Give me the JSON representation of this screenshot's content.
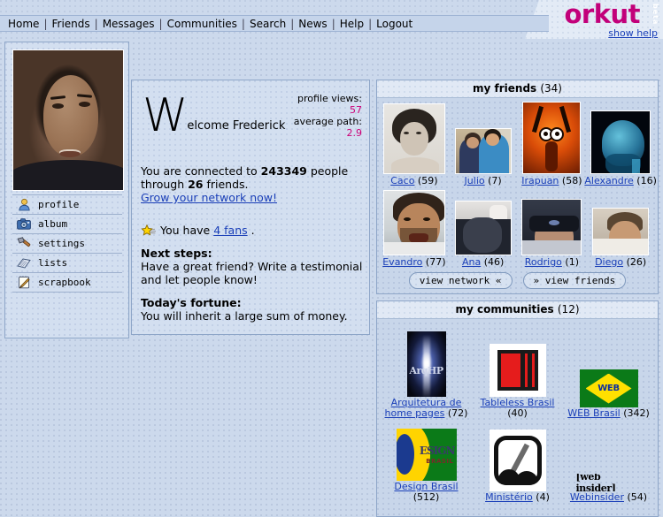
{
  "header": {
    "nav": [
      {
        "label": "Home"
      },
      {
        "label": "Friends"
      },
      {
        "label": "Messages"
      },
      {
        "label": "Communities"
      },
      {
        "label": "Search"
      },
      {
        "label": "News"
      },
      {
        "label": "Help"
      },
      {
        "label": "Logout"
      }
    ],
    "separator": "|",
    "logo": "orkut",
    "beta": "beta",
    "show_help": "show help",
    "logo_color": "#c2007a"
  },
  "sidebar": {
    "items": [
      {
        "label": "profile",
        "icon": "person-icon"
      },
      {
        "label": "album",
        "icon": "camera-icon"
      },
      {
        "label": "settings",
        "icon": "hammer-icon"
      },
      {
        "label": "lists",
        "icon": "papers-icon"
      },
      {
        "label": "scrapbook",
        "icon": "notepad-pencil-icon"
      }
    ]
  },
  "welcome": {
    "dropcap": "W",
    "greeting": "elcome Frederick",
    "stats": [
      {
        "label": "profile views:",
        "value": "57"
      },
      {
        "label": "average path:",
        "value": "2.9"
      }
    ],
    "connected_prefix": "You are connected to ",
    "connected_people": "243349",
    "connected_mid": " people through ",
    "connected_friends": "26",
    "connected_suffix": " friends.",
    "grow_link": "Grow your network now!",
    "fans_prefix": "You have ",
    "fans_link": "4 fans",
    "fans_suffix": ".",
    "next_steps_title": "Next steps:",
    "next_steps_body": "Have a great friend? Write a testimonial and let people know!",
    "fortune_title": "Today's fortune:",
    "fortune_body": "You will inherit a large sum of money.",
    "stat_value_color": "#cc0077"
  },
  "friends": {
    "title": "my friends",
    "count": "(34)",
    "people": [
      {
        "name": "Caco",
        "count": "(59)",
        "art": "tn-caco"
      },
      {
        "name": "Julio",
        "count": "(7)",
        "art": "tn-julio"
      },
      {
        "name": "Irapuan",
        "count": "(58)",
        "art": "tn-irapuan"
      },
      {
        "name": "Alexandre",
        "count": "(16)",
        "art": "tn-alex"
      },
      {
        "name": "Evandro",
        "count": "(77)",
        "art": "tn-evandro"
      },
      {
        "name": "Ana",
        "count": "(46)",
        "art": "tn-ana"
      },
      {
        "name": "Rodrigo",
        "count": "(1)",
        "art": "tn-rodrigo"
      },
      {
        "name": "Diego",
        "count": "(26)",
        "art": "tn-diego"
      }
    ],
    "view_network_label": "view network «",
    "view_friends_label": "» view friends"
  },
  "communities": {
    "title": "my communities",
    "count": "(12)",
    "items": [
      {
        "name": "Arquitetura de home pages",
        "count": "(72)",
        "art": "ci-arqhp",
        "logo_text": "ArqHP"
      },
      {
        "name": "Tableless Brasil",
        "count": "(40)",
        "art": "ci-tableless"
      },
      {
        "name": "WEB Brasil",
        "count": "(342)",
        "art": "ci-web",
        "logo_text": "WEB"
      },
      {
        "name": "Design Brasil",
        "count": "(512)",
        "art": "ci-design",
        "logo_text": "ESIGN",
        "logo_text2": "BRASIL"
      },
      {
        "name": "Ministério",
        "count": "(4)",
        "art": "ci-min"
      },
      {
        "name": "Webinsider",
        "count": "(54)",
        "art": "ci-wi",
        "logo_text": "[web insider]"
      }
    ]
  }
}
